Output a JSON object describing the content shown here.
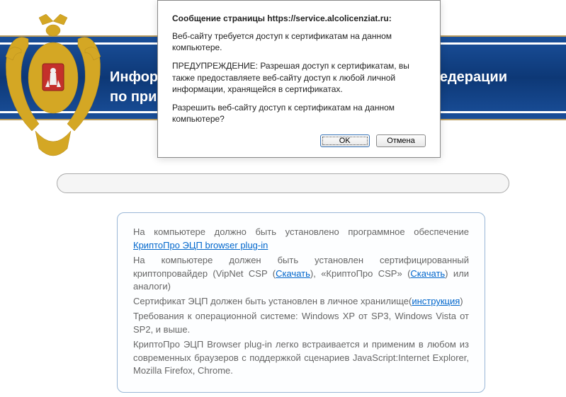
{
  "header": {
    "line1": "Информ",
    "line1_cont": "Федерации",
    "line2": "по при"
  },
  "dialog": {
    "title": "Сообщение страницы https://service.alcolicenziat.ru:",
    "p1": "Веб-сайту требуется доступ к сертификатам на данном компьютере.",
    "p2": "ПРЕДУПРЕЖДЕНИЕ: Разрешая доступ к сертификатам, вы также предоставляете веб-сайту доступ к любой личной информации, хранящейся в сертификатах.",
    "p3": "Разрешить веб-сайту доступ к сертификатам на данном компьютере?",
    "ok": "OK",
    "cancel": "Отмена"
  },
  "info": {
    "p1_a": "На компьютере должно быть установлено программное обеспечение ",
    "link1": "КриптоПро ЭЦП browser plug-in",
    "p2_a": "На компьютере должен быть установлен сертифицированный криптопровайдер (VipNet CSP (",
    "link2": "Скачать",
    "p2_b": "), «КриптоПро CSP» (",
    "link3": "Скачать",
    "p2_c": ") или аналоги)",
    "p3_a": "Сертификат ЭЦП должен быть установлен в личное хранилище(",
    "link4": "инструкция",
    "p3_b": ")",
    "p4": "Требования к операционной системе: Windows XP от SP3, Windows Vista от SP2, и выше.",
    "p5": "КриптоПро ЭЦП Browser plug-in легко встраивается и применим в любом из современных браузеров с поддержкой сценариев JavaScript:Internet Explorer, Mozilla Firefox, Chrome."
  }
}
